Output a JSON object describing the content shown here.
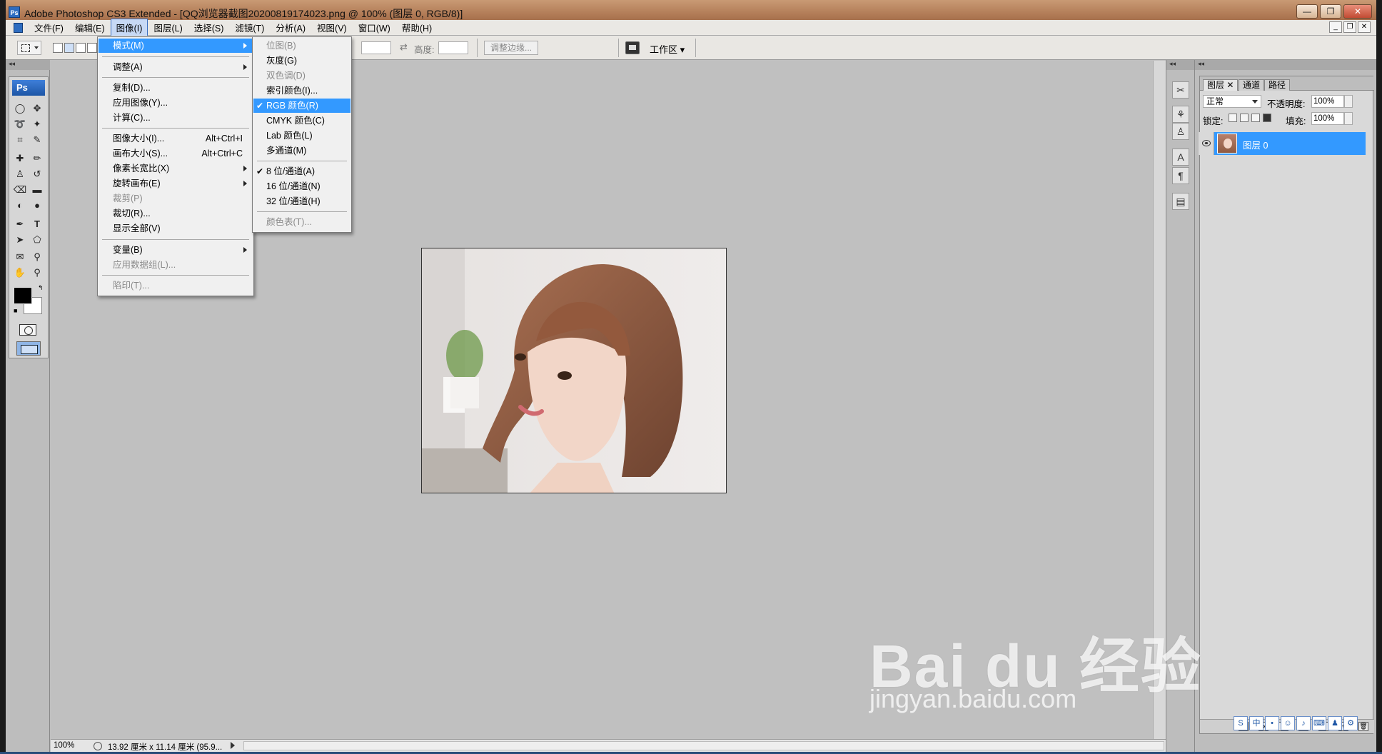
{
  "window": {
    "title": "Adobe Photoshop CS3 Extended - [QQ浏览器截图20200819174023.png @ 100% (图层 0, RGB/8)]",
    "logo": "Ps",
    "buttons": [
      "minimize-icon",
      "restore-icon",
      "close-icon"
    ]
  },
  "menubar": {
    "items": [
      "文件(F)",
      "编辑(E)",
      "图像(I)",
      "图层(L)",
      "选择(S)",
      "滤镜(T)",
      "分析(A)",
      "视图(V)",
      "窗口(W)",
      "帮助(H)"
    ],
    "active_index": 2
  },
  "options": {
    "height_label": "高度:",
    "refine_edge": "调整边缘...",
    "workspace": "工作区 ▾"
  },
  "image_menu": {
    "items": [
      {
        "label": "模式(M)",
        "submenu": true,
        "highlight": true
      },
      {
        "label": "调整(A)",
        "submenu": true
      },
      {
        "label": "复制(D)..."
      },
      {
        "label": "应用图像(Y)..."
      },
      {
        "label": "计算(C)..."
      },
      {
        "label": "图像大小(I)...",
        "shortcut": "Alt+Ctrl+I"
      },
      {
        "label": "画布大小(S)...",
        "shortcut": "Alt+Ctrl+C"
      },
      {
        "label": "像素长宽比(X)",
        "submenu": true
      },
      {
        "label": "旋转画布(E)",
        "submenu": true
      },
      {
        "label": "裁剪(P)",
        "disabled": true
      },
      {
        "label": "裁切(R)..."
      },
      {
        "label": "显示全部(V)"
      },
      {
        "label": "变量(B)",
        "submenu": true
      },
      {
        "label": "应用数据组(L)...",
        "disabled": true
      },
      {
        "label": "陷印(T)...",
        "disabled": true
      }
    ]
  },
  "mode_submenu": {
    "items": [
      {
        "label": "位图(B)",
        "disabled": true
      },
      {
        "label": "灰度(G)"
      },
      {
        "label": "双色调(D)",
        "disabled": true
      },
      {
        "label": "索引颜色(I)..."
      },
      {
        "label": "RGB 颜色(R)",
        "checked": true,
        "highlight": true
      },
      {
        "label": "CMYK 颜色(C)"
      },
      {
        "label": "Lab 颜色(L)"
      },
      {
        "label": "多通道(M)"
      },
      {
        "label": "8 位/通道(A)",
        "checked": true
      },
      {
        "label": "16 位/通道(N)"
      },
      {
        "label": "32 位/通道(H)"
      },
      {
        "label": "颜色表(T)...",
        "disabled": true
      }
    ]
  },
  "status": {
    "zoom": "100%",
    "doc_info": "13.92 厘米 x 11.14 厘米 (95.9..."
  },
  "layers_panel": {
    "tabs": [
      "图层",
      "通道",
      "路径"
    ],
    "blend_mode": "正常",
    "opacity_label": "不透明度:",
    "opacity_value": "100%",
    "lock_label": "锁定:",
    "fill_label": "填充:",
    "fill_value": "100%",
    "layer_name": "图层 0"
  },
  "watermark": {
    "brand": "Bai du 经验",
    "url": "jingyan.baidu.com"
  },
  "colors": {
    "highlight": "#3399ff",
    "canvas_bg": "#c0c0c0",
    "menu_bg": "#f0f0f0"
  }
}
